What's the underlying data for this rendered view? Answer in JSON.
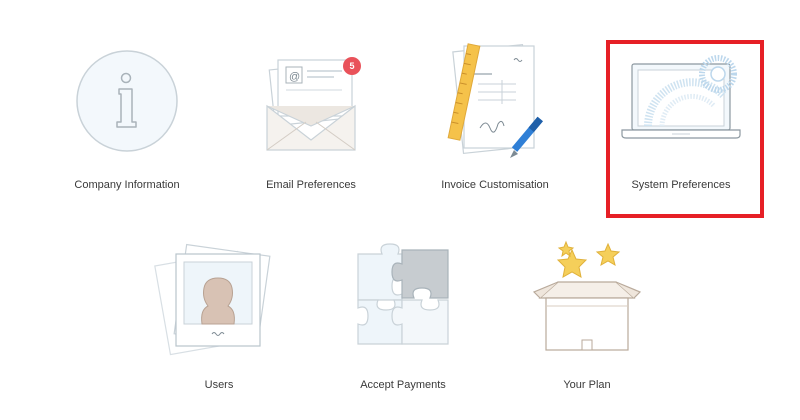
{
  "tiles": {
    "company_information": {
      "label": "Company Information"
    },
    "email_preferences": {
      "label": "Email Preferences",
      "badge_count": "5"
    },
    "invoice_customisation": {
      "label": "Invoice Customisation"
    },
    "system_preferences": {
      "label": "System Preferences",
      "selected": true
    },
    "users": {
      "label": "Users"
    },
    "accept_payments": {
      "label": "Accept Payments"
    },
    "your_plan": {
      "label": "Your Plan"
    }
  },
  "icons": {
    "company_information": "info-icon",
    "email_preferences": "envelope-icon",
    "invoice_customisation": "invoice-icon",
    "system_preferences": "laptop-icon",
    "users": "photo-user-icon",
    "accept_payments": "puzzle-icon",
    "your_plan": "gift-box-icon"
  },
  "colors": {
    "highlight": "#e61f26",
    "badge": "#e9525a",
    "line": "#b9c4cc",
    "light_fill": "#eef5fa",
    "pencil_yellow": "#f5c24a",
    "pen_blue": "#2f7fd6",
    "star_yellow": "#f5cf5a",
    "avatar": "#d8c2b4",
    "puzzle_grey": "#c7ccd0"
  }
}
